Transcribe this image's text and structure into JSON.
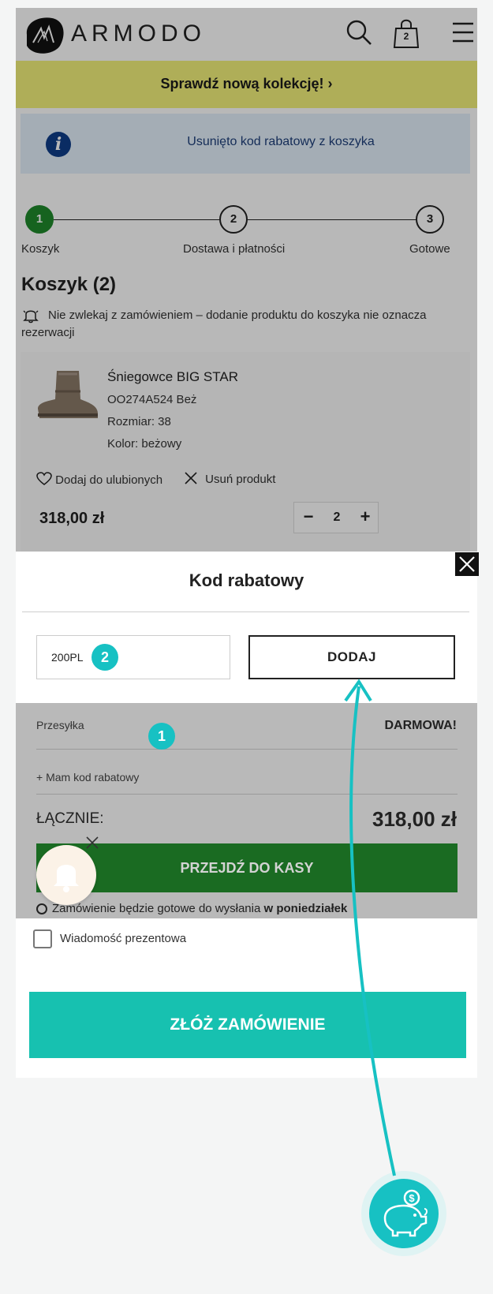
{
  "header": {
    "brand": "ARMODO",
    "cart_count": "2",
    "promo": "Sprawdź nową kolekcję! ›"
  },
  "notice": {
    "text": "Usunięto kod rabatowy z koszyka"
  },
  "steps": [
    {
      "number": "1",
      "label": "Koszyk"
    },
    {
      "number": "2",
      "label": "Dostawa i płatności"
    },
    {
      "number": "3",
      "label": "Gotowe"
    }
  ],
  "cart": {
    "title": "Koszyk (2)",
    "warning": "Nie zwlekaj z zamówieniem – dodanie produktu do koszyka nie oznacza rezerwacji",
    "item": {
      "name": "Śniegowce BIG STAR",
      "sku": "OO274A524 Beż",
      "size": "Rozmiar: 38",
      "color": "Kolor: beżowy",
      "favorite_label": "Dodaj do ulubionych",
      "remove_label": "Usuń produkt",
      "price": "318,00 zł",
      "quantity": "2",
      "minus": "−",
      "plus": "+"
    }
  },
  "modal": {
    "title": "Kod rabatowy",
    "code_value": "200PL",
    "add_label": "DODAJ",
    "badge_code": "2"
  },
  "summary": {
    "shipping_label": "Przesyłka",
    "shipping_value": "DARMOWA!",
    "promo_toggle": "+ Mam kod rabatowy",
    "badge_toggle": "1",
    "total_label": "ŁĄCZNIE:",
    "total_value": "318,00 zł",
    "checkout_label": "PRZEJDŹ DO KASY",
    "ship_note_prefix": "Zamówienie będzie gotowe do wysłania",
    "ship_note_bold": "w poniedziałek"
  },
  "bottom": {
    "gift_label": "Wiadomość prezentowa",
    "place_order_label": "ZŁÓŻ ZAMÓWIENIE"
  },
  "colors": {
    "accent_teal": "#17c1c3",
    "checkout_green": "#1f8a2c",
    "promo_yellow": "#f3f17a",
    "notice_blue": "#e3f0fb"
  }
}
